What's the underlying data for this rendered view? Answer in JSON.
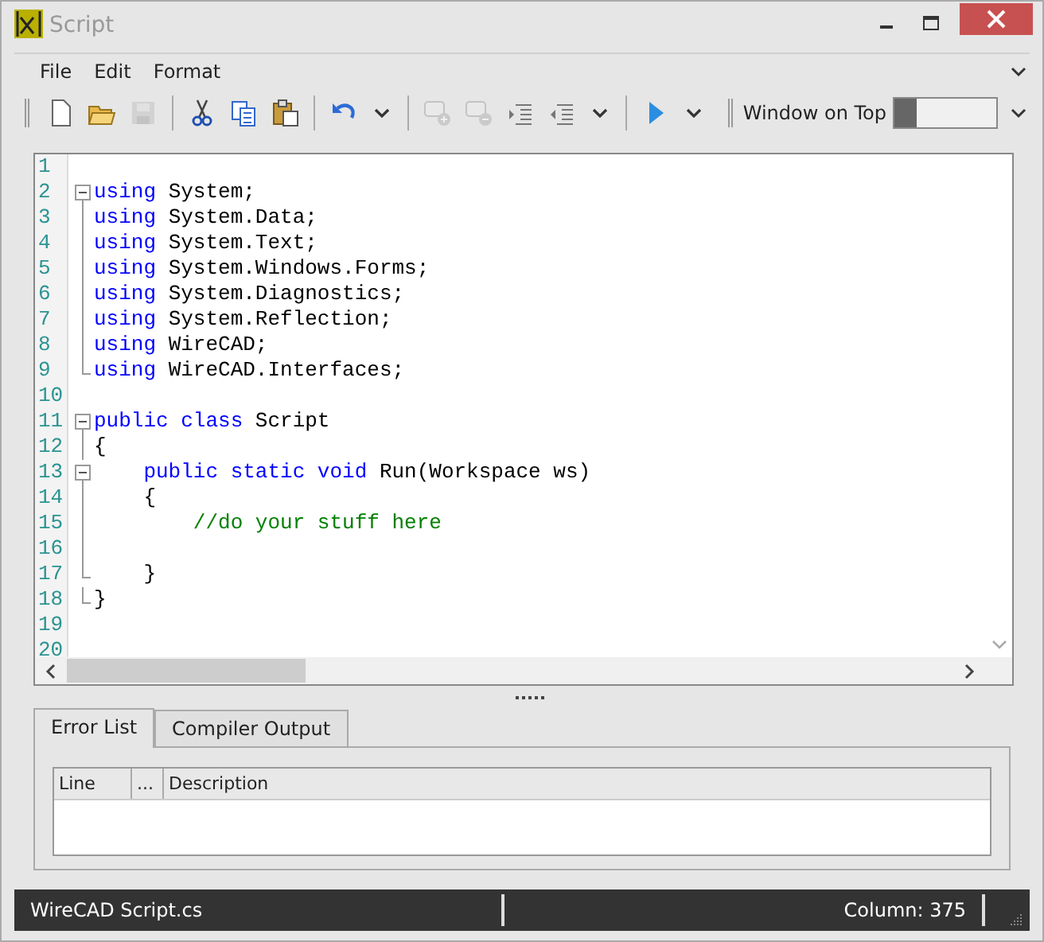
{
  "window": {
    "title": "Script"
  },
  "menu": [
    "File",
    "Edit",
    "Format"
  ],
  "toolbar": [
    {
      "kind": "new",
      "disabled": false
    },
    {
      "kind": "open",
      "disabled": false
    },
    {
      "kind": "save",
      "disabled": true
    },
    {
      "kind": "sep"
    },
    {
      "kind": "cut",
      "disabled": false
    },
    {
      "kind": "copy",
      "disabled": false
    },
    {
      "kind": "paste",
      "disabled": false
    },
    {
      "kind": "sep"
    },
    {
      "kind": "undo",
      "disabled": false
    },
    {
      "kind": "caret",
      "disabled": false
    },
    {
      "kind": "sep"
    },
    {
      "kind": "comment",
      "disabled": true
    },
    {
      "kind": "uncomment",
      "disabled": true
    },
    {
      "kind": "indent",
      "disabled": false
    },
    {
      "kind": "outdent",
      "disabled": false
    },
    {
      "kind": "caret",
      "disabled": false
    },
    {
      "kind": "sep"
    },
    {
      "kind": "run",
      "disabled": false
    },
    {
      "kind": "caret",
      "disabled": false
    }
  ],
  "window_on_top": {
    "label": "Window on Top",
    "on": false
  },
  "editor": {
    "lines": [
      {
        "number": "1",
        "fold_start": false,
        "fold_end": false
      },
      {
        "number": "2",
        "fold_start": true,
        "fold_end": false,
        "tokens": [
          {
            "kind": "keyword",
            "text": "using"
          },
          {
            "kind": "plain",
            "text": " System;"
          }
        ]
      },
      {
        "number": "3",
        "fold_start": false,
        "fold_end": false,
        "tokens": [
          {
            "kind": "keyword",
            "text": "using"
          },
          {
            "kind": "plain",
            "text": " System.Data;"
          }
        ]
      },
      {
        "number": "4",
        "fold_start": false,
        "fold_end": false,
        "tokens": [
          {
            "kind": "keyword",
            "text": "using"
          },
          {
            "kind": "plain",
            "text": " System.Text;"
          }
        ]
      },
      {
        "number": "5",
        "fold_start": false,
        "fold_end": false,
        "tokens": [
          {
            "kind": "keyword",
            "text": "using"
          },
          {
            "kind": "plain",
            "text": " System.Windows.Forms;"
          }
        ]
      },
      {
        "number": "6",
        "fold_start": false,
        "fold_end": false,
        "tokens": [
          {
            "kind": "keyword",
            "text": "using"
          },
          {
            "kind": "plain",
            "text": " System.Diagnostics;"
          }
        ]
      },
      {
        "number": "7",
        "fold_start": false,
        "fold_end": false,
        "tokens": [
          {
            "kind": "keyword",
            "text": "using"
          },
          {
            "kind": "plain",
            "text": " System.Reflection;"
          }
        ]
      },
      {
        "number": "8",
        "fold_start": false,
        "fold_end": false,
        "tokens": [
          {
            "kind": "keyword",
            "text": "using"
          },
          {
            "kind": "plain",
            "text": " WireCAD;"
          }
        ]
      },
      {
        "number": "9",
        "fold_start": false,
        "fold_end": true,
        "tokens": [
          {
            "kind": "keyword",
            "text": "using"
          },
          {
            "kind": "plain",
            "text": " WireCAD.Interfaces;"
          }
        ]
      },
      {
        "number": "10",
        "fold_start": false,
        "fold_end": false
      },
      {
        "number": "11",
        "fold_start": true,
        "fold_end": false,
        "tokens": [
          {
            "kind": "keyword",
            "text": "public class"
          },
          {
            "kind": "plain",
            "text": " Script"
          }
        ]
      },
      {
        "number": "12",
        "fold_start": false,
        "fold_end": false,
        "tokens": [
          {
            "kind": "plain",
            "text": "{"
          }
        ]
      },
      {
        "number": "13",
        "fold_start": true,
        "fold_end": false,
        "tokens": [
          {
            "kind": "keyword",
            "text": "    public static void"
          },
          {
            "kind": "plain",
            "text": " Run(Workspace ws)"
          }
        ]
      },
      {
        "number": "14",
        "fold_start": false,
        "fold_end": false,
        "tokens": [
          {
            "kind": "plain",
            "text": "    {"
          }
        ]
      },
      {
        "number": "15",
        "fold_start": false,
        "fold_end": false,
        "tokens": [
          {
            "kind": "comment",
            "text": "        //do your stuff here"
          }
        ]
      },
      {
        "number": "16",
        "fold_start": false,
        "fold_end": false
      },
      {
        "number": "17",
        "fold_start": false,
        "fold_end": true,
        "tokens": [
          {
            "kind": "plain",
            "text": "    }"
          }
        ]
      },
      {
        "number": "18",
        "fold_start": false,
        "fold_end": true,
        "tokens": [
          {
            "kind": "plain",
            "text": "}"
          }
        ]
      },
      {
        "number": "19",
        "fold_start": false,
        "fold_end": false
      },
      {
        "number": "20",
        "fold_start": false,
        "fold_end": false
      }
    ]
  },
  "tabs": [
    {
      "label": "Error List",
      "selected": true
    },
    {
      "label": "Compiler Output",
      "selected": false
    }
  ],
  "error_table": {
    "columns": [
      "Line",
      "...",
      "Description"
    ]
  },
  "status_bar": {
    "file": "WireCAD Script.cs",
    "column": "Column: 375"
  }
}
